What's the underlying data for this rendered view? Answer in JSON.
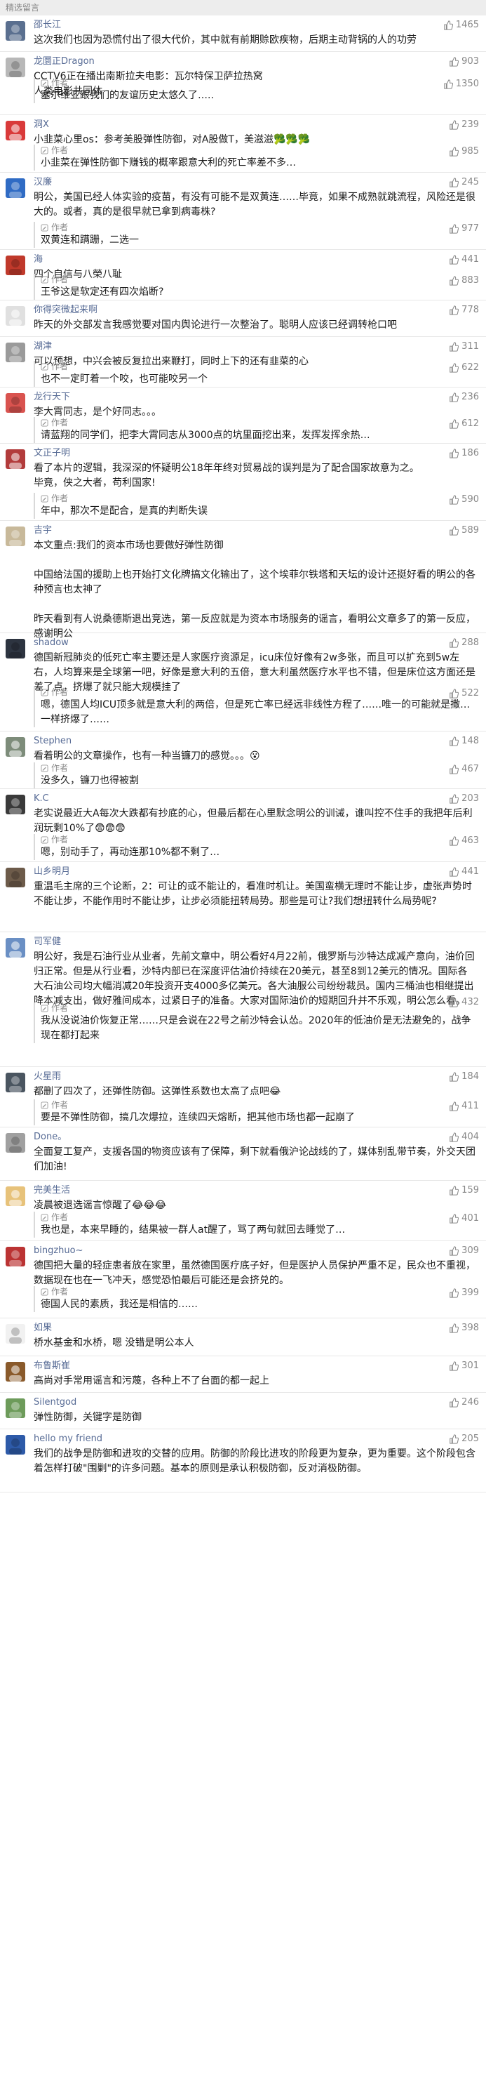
{
  "header": {
    "title": "精选留言"
  },
  "reply_author_label": "作者",
  "comments": [
    {
      "name": "邵长江",
      "likes": "1465",
      "avatar": "bird-avatar",
      "avatar_color": "#5a6f8f",
      "content": "这次我们也因为恐慌付出了很大代价，其中就有前期赊欧疾物，后期主动背锅的人的功劳",
      "reply": null
    },
    {
      "name": "龙圜正Dragon",
      "likes": "903",
      "avatar": "figure-avatar",
      "avatar_color": "#b8b8b8",
      "content": "CCTV6正在播出南斯拉夫电影：瓦尔特保卫萨拉热窝\n人类电影共同体",
      "reply": {
        "likes": "1350",
        "text": "塞尔维亚跟我们的友谊历史太悠久了….."
      }
    },
    {
      "name": "洞X",
      "likes": "239",
      "avatar": "red-logo-avatar",
      "avatar_color": "#d93a3a",
      "content": "小韭菜心里os：参考美股弹性防御，对A股做T，美滋滋🥦🥦🥦",
      "reply": {
        "likes": "985",
        "text": "小韭菜在弹性防御下赚钱的概率跟意大利的死亡率差不多…"
      }
    },
    {
      "name": "汉廉",
      "likes": "245",
      "avatar": "flag-avatar",
      "avatar_color": "#2f6bc4",
      "content": "明公，美国已经人体实验的疫苗，有没有可能不是双黄连……毕竟，如果不成熟就跳流程，风险还是很大的。或者，真的是很早就已拿到病毒株?",
      "reply": {
        "likes": "977",
        "text": "双黄连和蹒跚，二选一"
      }
    },
    {
      "name": "海",
      "likes": "441",
      "avatar": "red-figure-avatar",
      "avatar_color": "#c0392b",
      "content": "四个自信与八榮八耻",
      "reply": {
        "likes": "883",
        "text": "王爷这是软定还有四次焰断?"
      }
    },
    {
      "name": "你得突微起来啊",
      "likes": "778",
      "avatar": "cartoon-avatar",
      "avatar_color": "#e0e0e0",
      "content": "昨天的外交部发言我感觉要对国内舆论进行一次整治了。聪明人应该已经调转枪口吧",
      "reply": null
    },
    {
      "name": "湖津",
      "likes": "311",
      "avatar": "doll-avatar",
      "avatar_color": "#9a9a9a",
      "content": "可以预想，中兴会被反复拉出来鞭打，同时上下的还有韭菜的心",
      "reply": {
        "likes": "622",
        "text": "也不一定盯着一个咬，也可能咬另一个"
      }
    },
    {
      "name": "龙行天下",
      "likes": "236",
      "avatar": "dragon-avatar",
      "avatar_color": "#d9534f",
      "content": "李大霄同志，是个好同志。。。",
      "reply": {
        "likes": "612",
        "text": "请蓝翔的同学们，把李大霄同志从3000点的坑里面挖出来，发挥发挥余热…"
      }
    },
    {
      "name": "文正子明",
      "likes": "186",
      "avatar": "red-pattern-avatar",
      "avatar_color": "#b23b3b",
      "content": "看了本片的逻辑，我深深的怀疑明公18年年终对贸易战的误判是为了配合国家故意为之。\n毕竟，侠之大者，苟利国家!",
      "reply": {
        "likes": "590",
        "text": "年中，那次不是配合，是真的判断失误"
      }
    },
    {
      "name": "吉宇",
      "likes": "589",
      "avatar": "wave-avatar",
      "avatar_color": "#c8b99a",
      "content": "本文重点:我们的资本市场也要做好弹性防御\n\n中国给法国的援助上也开始打文化牌搞文化输出了，这个埃菲尔铁塔和天坛的设计还挺好看的明公的各种预言也太神了\n\n昨天看到有人说桑德斯退出竞选，第一反应就是为资本市场服务的谣言，看明公文章多了的第一反应，感谢明公",
      "reply": null
    },
    {
      "name": "shadow",
      "likes": "288",
      "avatar": "dark-avatar",
      "avatar_color": "#2d3440",
      "content": "德国新冠肺炎的低死亡率主要还是人家医疗资源足，icu床位好像有2w多张，而且可以扩充到5w左右，人均算来是全球第一吧，好像是意大利的五倍，意大利虽然医疗水平也不错，但是床位这方面还是差了点，挤爆了就只能大规模挂了",
      "reply": {
        "likes": "522",
        "text": "嗯，德国人均ICU顶多就是意大利的两倍，但是死亡率已经远非线性方程了……唯一的可能就是撒…一样挤爆了……"
      }
    },
    {
      "name": "Stephen",
      "likes": "148",
      "avatar": "photo-avatar",
      "avatar_color": "#7d8c7a",
      "content": "看着明公的文章操作，也有一种当镰刀的感觉。。。😮",
      "reply": {
        "likes": "467",
        "text": "没多久，镰刀也得被割"
      }
    },
    {
      "name": "K.C",
      "likes": "203",
      "avatar": "letter-avatar",
      "avatar_color": "#3a3a3a",
      "content": "老实说最近大A每次大跌都有抄底的心，但最后都在心里默念明公的训诫，谁叫控不住手的我把年后利润玩剩10%了😨😨😨",
      "reply": {
        "likes": "463",
        "text": "嗯，别动手了，再动连那10%都不剩了…"
      }
    },
    {
      "name": "山乡明月",
      "likes": "441",
      "avatar": "landscape-avatar",
      "avatar_color": "#6d5b4a",
      "content": "重温毛主席的三个论断，2：可让的或不能让的，看准时机让。美国蛮横无理时不能让步，虚张声势时不能让步，不能作用时不能让步，让步必须能扭转局势。那些是可让?我们想扭转什么局势呢?",
      "reply": null
    },
    {
      "name": "司军健",
      "likes": "",
      "avatar": "sky-avatar",
      "avatar_color": "#6a8fc4",
      "content": "明公好，我是石油行业从业者，先前文章中，明公看好4月22前，俄罗斯与沙特达成减产意向，油价回归正常。但是从行业看，沙特内部已在深度评估油价持续在20美元，甚至8到12美元的情况。国际各大石油公司均大幅消减20年投资开支4000多亿美元。各大油服公司纷纷裁员。国内三桶油也相继提出降本减支出，做好雅间成本，过紧日子的准备。大家对国际油价的短期回升并不乐观，明公怎么看。",
      "reply": {
        "likes": "432",
        "text": "我从没说油价恢复正常……只是会说在22号之前沙特会认怂。2020年的低油价是无法避免的，战争现在都打起来"
      }
    },
    {
      "name": "火星雨",
      "likes": "184",
      "avatar": "meteor-avatar",
      "avatar_color": "#4a5560",
      "content": "都删了四次了，还弹性防御。这弹性系数也太高了点吧😂",
      "reply": {
        "likes": "411",
        "text": "要是不弹性防御，搞几次爆拉，连续四天熔断，把其他市场也都一起崩了"
      }
    },
    {
      "name": "Done。",
      "likes": "404",
      "avatar": "gray-avatar",
      "avatar_color": "#a0a0a0",
      "content": "全面复工复产，支援各国的物资应该有了保障，剩下就看俄沪论战线的了，媒体别乱带节奏，外交天团们加油!",
      "reply": null
    },
    {
      "name": "完美生活",
      "likes": "159",
      "avatar": "cartoon-face-avatar",
      "avatar_color": "#e7c27a",
      "content": "凌晨被退选谣言惊醒了😂😂😂",
      "reply": {
        "likes": "401",
        "text": "我也是，本来早睡的，结果被一群人at醒了，骂了两句就回去睡觉了…"
      }
    },
    {
      "name": "bingzhuo~",
      "likes": "309",
      "avatar": "red-blue-avatar",
      "avatar_color": "#b33",
      "content": "德国把大量的轻症患者放在家里，虽然德国医疗底子好，但是医护人员保护严重不足，民众也不重视，数据现在也在一飞冲天，感觉恐怕最后可能还是会挤兑的。",
      "reply": {
        "likes": "399",
        "text": "德国人民的素质，我还是相信的……"
      }
    },
    {
      "name": "如果",
      "likes": "398",
      "avatar": "white-avatar",
      "avatar_color": "#f1f1f1",
      "content": "桥水基金和水桥，嗯 没错是明公本人",
      "reply": null
    },
    {
      "name": "布鲁斯崔",
      "likes": "301",
      "avatar": "lion-avatar",
      "avatar_color": "#8a5a2b",
      "content": "高尚对手常用谣言和污蔑，各种上不了台面的都一起上",
      "reply": null
    },
    {
      "name": "Silentgod",
      "likes": "246",
      "avatar": "green-avatar",
      "avatar_color": "#6d9b5a",
      "content": "弹性防御，关键字是防御",
      "reply": null
    },
    {
      "name": "hello my friend",
      "likes": "205",
      "avatar": "emblem-avatar",
      "avatar_color": "#2d5aa8",
      "content": "我们的战争是防御和进攻的交替的应用。防御的阶段比进攻的阶段更为复杂，更为重要。这个阶段包含着怎样打破\"围剿\"的许多问题。基本的原则是承认积极防御，反对消极防御。",
      "reply": null
    }
  ]
}
